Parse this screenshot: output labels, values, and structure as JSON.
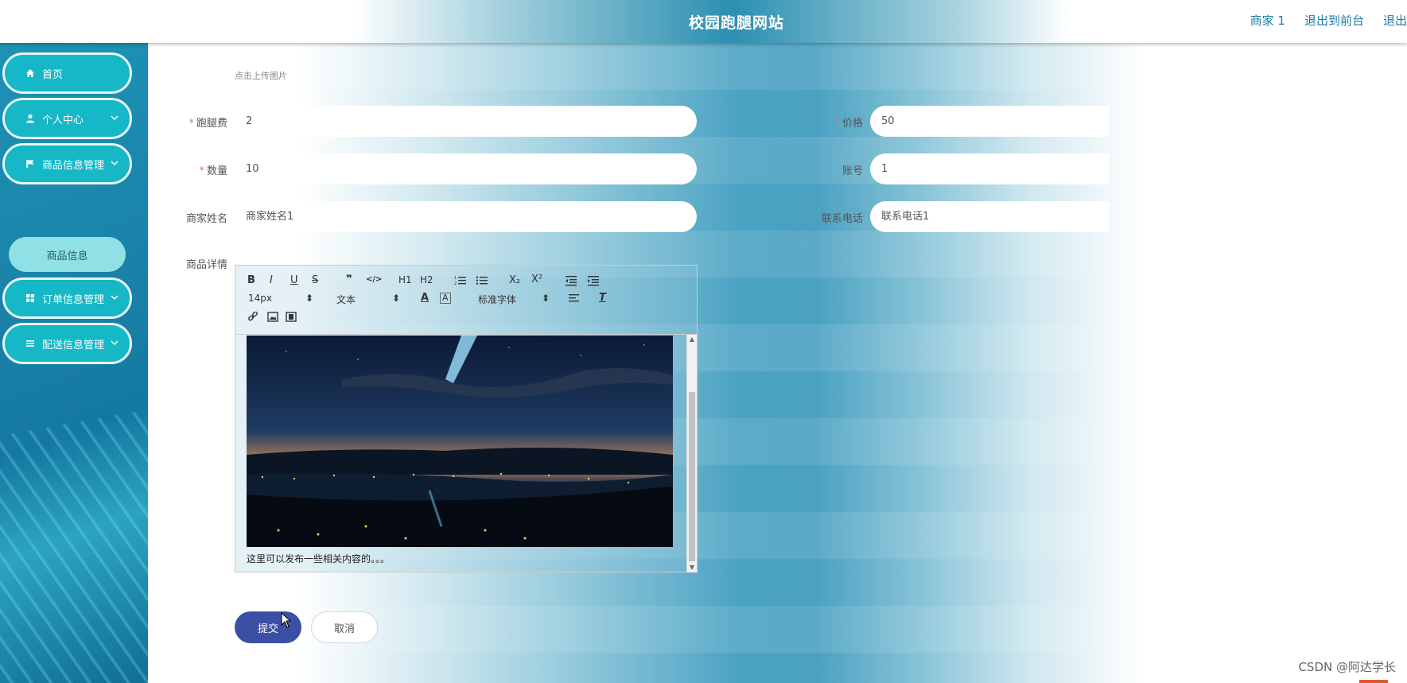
{
  "header": {
    "title": "校园跑腿网站",
    "links": [
      "商家 1",
      "退出到前台",
      "退出"
    ]
  },
  "sidebar": {
    "items": [
      {
        "label": "首页",
        "icon": "home-icon",
        "has_chevron": false
      },
      {
        "label": "个人中心",
        "icon": "user-icon",
        "has_chevron": true
      },
      {
        "label": "商品信息管理",
        "icon": "flag-icon",
        "has_chevron": true
      },
      {
        "label": "订单信息管理",
        "icon": "grid-icon",
        "has_chevron": true
      },
      {
        "label": "配送信息管理",
        "icon": "list-icon",
        "has_chevron": true
      }
    ],
    "submenu_item": "商品信息"
  },
  "form": {
    "upload_hint": "点击上传图片",
    "errand_fee": {
      "label": "跑腿费",
      "value": "2",
      "required": true
    },
    "price": {
      "label": "价格",
      "value": "50",
      "required": true
    },
    "quantity": {
      "label": "数量",
      "value": "10",
      "required": true
    },
    "account": {
      "label": "账号",
      "value": "1",
      "required": false
    },
    "merchant_name": {
      "label": "商家姓名",
      "value": "商家姓名1",
      "required": false
    },
    "contact_phone": {
      "label": "联系电话",
      "value": "联系电话1",
      "required": false
    },
    "details_label": "商品详情"
  },
  "editor": {
    "toolbar_row1": [
      "B",
      "I",
      "U",
      "S",
      "❞",
      "</>",
      "H1",
      "H2",
      "ordered-list",
      "bullet-list",
      "X₂",
      "X²",
      "outdent",
      "indent"
    ],
    "font_size": "14px",
    "header_select": "文本",
    "font_family": "标准字体",
    "content_text": "这里可以发布一些相关内容的。。。"
  },
  "buttons": {
    "submit": "提交",
    "cancel": "取消"
  },
  "watermark": "CSDN @阿达学长",
  "colors": {
    "sidebar_button": "#16b7c6",
    "submenu": "#8fe1e5",
    "submit_button": "#3b4fa5",
    "required_star": "#f56c6c",
    "header_link": "#1a7ea6"
  }
}
